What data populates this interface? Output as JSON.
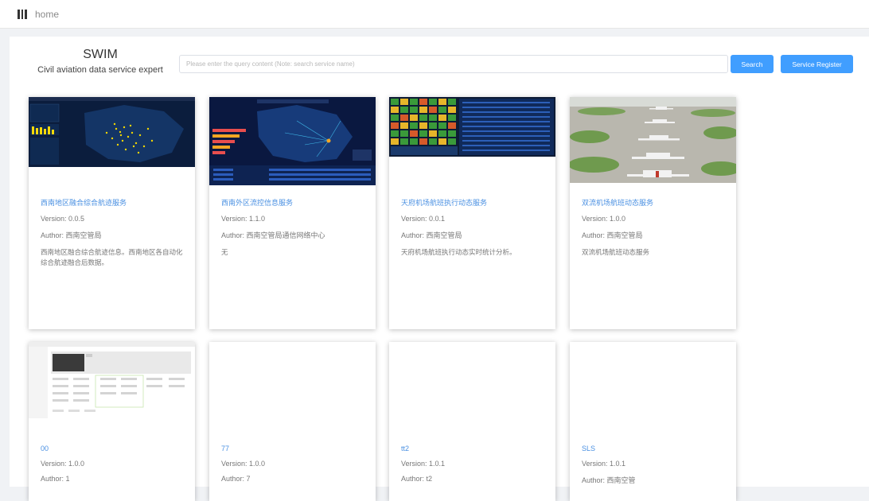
{
  "topbar": {
    "icon": "menu-icon",
    "breadcrumb": "home"
  },
  "brand": {
    "title": "SWIM",
    "subtitle": "Civil aviation data service expert"
  },
  "search": {
    "placeholder": "Please enter the query content (Note: search service name)",
    "value": ""
  },
  "buttons": {
    "search": "Search",
    "register": "Service Register"
  },
  "colors": {
    "accent": "#409eff",
    "link": "#4a90e2",
    "background": "#f0f2f5"
  },
  "cards": [
    {
      "name": "西南地区融合综合航迹服务",
      "version": "Version: 0.0.5",
      "author": "Author: 西南空管局",
      "description": "西南地区融合综合航迹信息。西南地区各自动化综合航迹融合后数据。",
      "thumbnail": "flight-tracks-map"
    },
    {
      "name": "西南外区流控信息服务",
      "version": "Version: 1.1.0",
      "author": "Author: 西南空管局通信网络中心",
      "description": "无",
      "thumbnail": "flow-control-dashboard"
    },
    {
      "name": "天府机场航班执行动态服务",
      "version": "Version: 0.0.1",
      "author": "Author: 西南空管局",
      "description": "天府机场航班执行动态实时统计分析。",
      "thumbnail": "flight-status-board"
    },
    {
      "name": "双流机场航班动态服务",
      "version": "Version: 1.0.0",
      "author": "Author: 西南空管局",
      "description": "双流机场航班动态服务",
      "thumbnail": "airport-photo"
    },
    {
      "name": "00",
      "version": "Version: 1.0.0",
      "author": "Author: 1",
      "description": "",
      "thumbnail": "web-page-screenshot"
    },
    {
      "name": "77",
      "version": "Version: 1.0.0",
      "author": "Author: 7",
      "description": "",
      "thumbnail": ""
    },
    {
      "name": "tt2",
      "version": "Version: 1.0.1",
      "author": "Author: t2",
      "description": "",
      "thumbnail": ""
    },
    {
      "name": "SLS",
      "version": "Version: 1.0.1",
      "author": "Author: 西南空管",
      "description": "",
      "thumbnail": ""
    }
  ]
}
